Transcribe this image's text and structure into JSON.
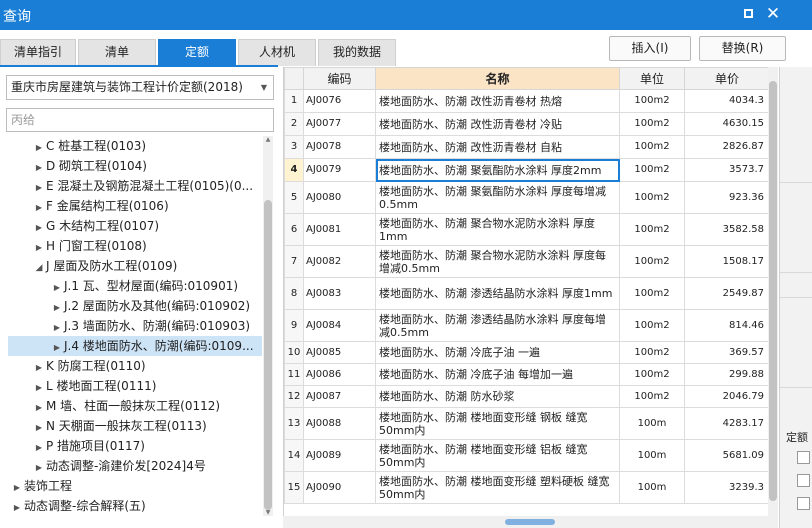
{
  "window": {
    "title": "查询"
  },
  "tabs": [
    "清单指引",
    "清单",
    "定额",
    "人材机",
    "我的数据"
  ],
  "active_tab": "定额",
  "actions": {
    "insert": "插入(I)",
    "replace": "替换(R)"
  },
  "quota_select": {
    "value": "重庆市房屋建筑与装饰工程计价定额(2018)"
  },
  "search": {
    "placeholder": "丙给"
  },
  "tree": [
    {
      "label": "C 桩基工程(0103)",
      "expanded": false,
      "selected": false
    },
    {
      "label": "D 砌筑工程(0104)",
      "expanded": false,
      "selected": false
    },
    {
      "label": "E 混凝土及钢筋混凝土工程(0105)(0...",
      "expanded": false,
      "selected": false
    },
    {
      "label": "F 金属结构工程(0106)",
      "expanded": false,
      "selected": false
    },
    {
      "label": "G 木结构工程(0107)",
      "expanded": false,
      "selected": false
    },
    {
      "label": "H 门窗工程(0108)",
      "expanded": false,
      "selected": false
    },
    {
      "label": "J 屋面及防水工程(0109)",
      "expanded": true,
      "selected": false
    },
    {
      "label": "J.1 瓦、型材屋面(编码:010901)",
      "expanded": false,
      "selected": false
    },
    {
      "label": "J.2 屋面防水及其他(编码:010902)",
      "expanded": false,
      "selected": false
    },
    {
      "label": "J.3 墙面防水、防潮(编码:010903)",
      "expanded": false,
      "selected": false
    },
    {
      "label": "J.4 楼地面防水、防潮(编码:0109...",
      "expanded": false,
      "selected": true
    },
    {
      "label": "K 防腐工程(0110)",
      "expanded": false,
      "selected": false
    },
    {
      "label": "L 楼地面工程(0111)",
      "expanded": false,
      "selected": false
    },
    {
      "label": "M 墙、柱面一般抹灰工程(0112)",
      "expanded": false,
      "selected": false
    },
    {
      "label": "N 天棚面一般抹灰工程(0113)",
      "expanded": false,
      "selected": false
    },
    {
      "label": "P 措施项目(0117)",
      "expanded": false,
      "selected": false
    },
    {
      "label": "动态调整-渝建价发[2024]4号",
      "expanded": false,
      "selected": false
    },
    {
      "label": "装饰工程",
      "expanded": false,
      "selected": false
    },
    {
      "label": "动态调整-综合解释(五)",
      "expanded": false,
      "selected": false
    }
  ],
  "table": {
    "columns": [
      "编码",
      "名称",
      "单位",
      "单价"
    ],
    "current_row": 4,
    "rows": [
      {
        "n": "1",
        "code": "AJ0076",
        "name": "楼地面防水、防潮 改性沥青卷材 热熔",
        "unit": "100m2",
        "price": "4034.3"
      },
      {
        "n": "2",
        "code": "AJ0077",
        "name": "楼地面防水、防潮 改性沥青卷材 冷贴",
        "unit": "100m2",
        "price": "4630.15"
      },
      {
        "n": "3",
        "code": "AJ0078",
        "name": "楼地面防水、防潮 改性沥青卷材 自粘",
        "unit": "100m2",
        "price": "2826.87"
      },
      {
        "n": "4",
        "code": "AJ0079",
        "name": "楼地面防水、防潮 聚氨酯防水涂料 厚度2mm",
        "unit": "100m2",
        "price": "3573.7"
      },
      {
        "n": "5",
        "code": "AJ0080",
        "name": "楼地面防水、防潮 聚氨酯防水涂料 厚度每增减0.5mm",
        "unit": "100m2",
        "price": "923.36"
      },
      {
        "n": "6",
        "code": "AJ0081",
        "name": "楼地面防水、防潮 聚合物水泥防水涂料 厚度1mm",
        "unit": "100m2",
        "price": "3582.58"
      },
      {
        "n": "7",
        "code": "AJ0082",
        "name": "楼地面防水、防潮 聚合物水泥防水涂料 厚度每增减0.5mm",
        "unit": "100m2",
        "price": "1508.17"
      },
      {
        "n": "8",
        "code": "AJ0083",
        "name": "楼地面防水、防潮 渗透结晶防水涂料 厚度1mm",
        "unit": "100m2",
        "price": "2549.87"
      },
      {
        "n": "9",
        "code": "AJ0084",
        "name": "楼地面防水、防潮 渗透结晶防水涂料 厚度每增减0.5mm",
        "unit": "100m2",
        "price": "814.46"
      },
      {
        "n": "10",
        "code": "AJ0085",
        "name": "楼地面防水、防潮 冷底子油 一遍",
        "unit": "100m2",
        "price": "369.57"
      },
      {
        "n": "11",
        "code": "AJ0086",
        "name": "楼地面防水、防潮 冷底子油 每增加一遍",
        "unit": "100m2",
        "price": "299.88"
      },
      {
        "n": "12",
        "code": "AJ0087",
        "name": "楼地面防水、防潮 防水砂浆",
        "unit": "100m2",
        "price": "2046.79"
      },
      {
        "n": "13",
        "code": "AJ0088",
        "name": "楼地面防水、防潮 楼地面变形缝 钢板 缝宽50mm内",
        "unit": "100m",
        "price": "4283.17"
      },
      {
        "n": "14",
        "code": "AJ0089",
        "name": "楼地面防水、防潮 楼地面变形缝 铝板 缝宽50mm内",
        "unit": "100m",
        "price": "5681.09"
      },
      {
        "n": "15",
        "code": "AJ0090",
        "name": "楼地面防水、防潮 楼地面变形缝 塑料硬板 缝宽50mm内",
        "unit": "100m",
        "price": "3239.3"
      }
    ]
  },
  "right_panel": {
    "label": "定额"
  },
  "colors": {
    "accent": "#1a7ed6",
    "header_highlight": "#fbe3c6",
    "selected_row": "#cde3f6"
  }
}
